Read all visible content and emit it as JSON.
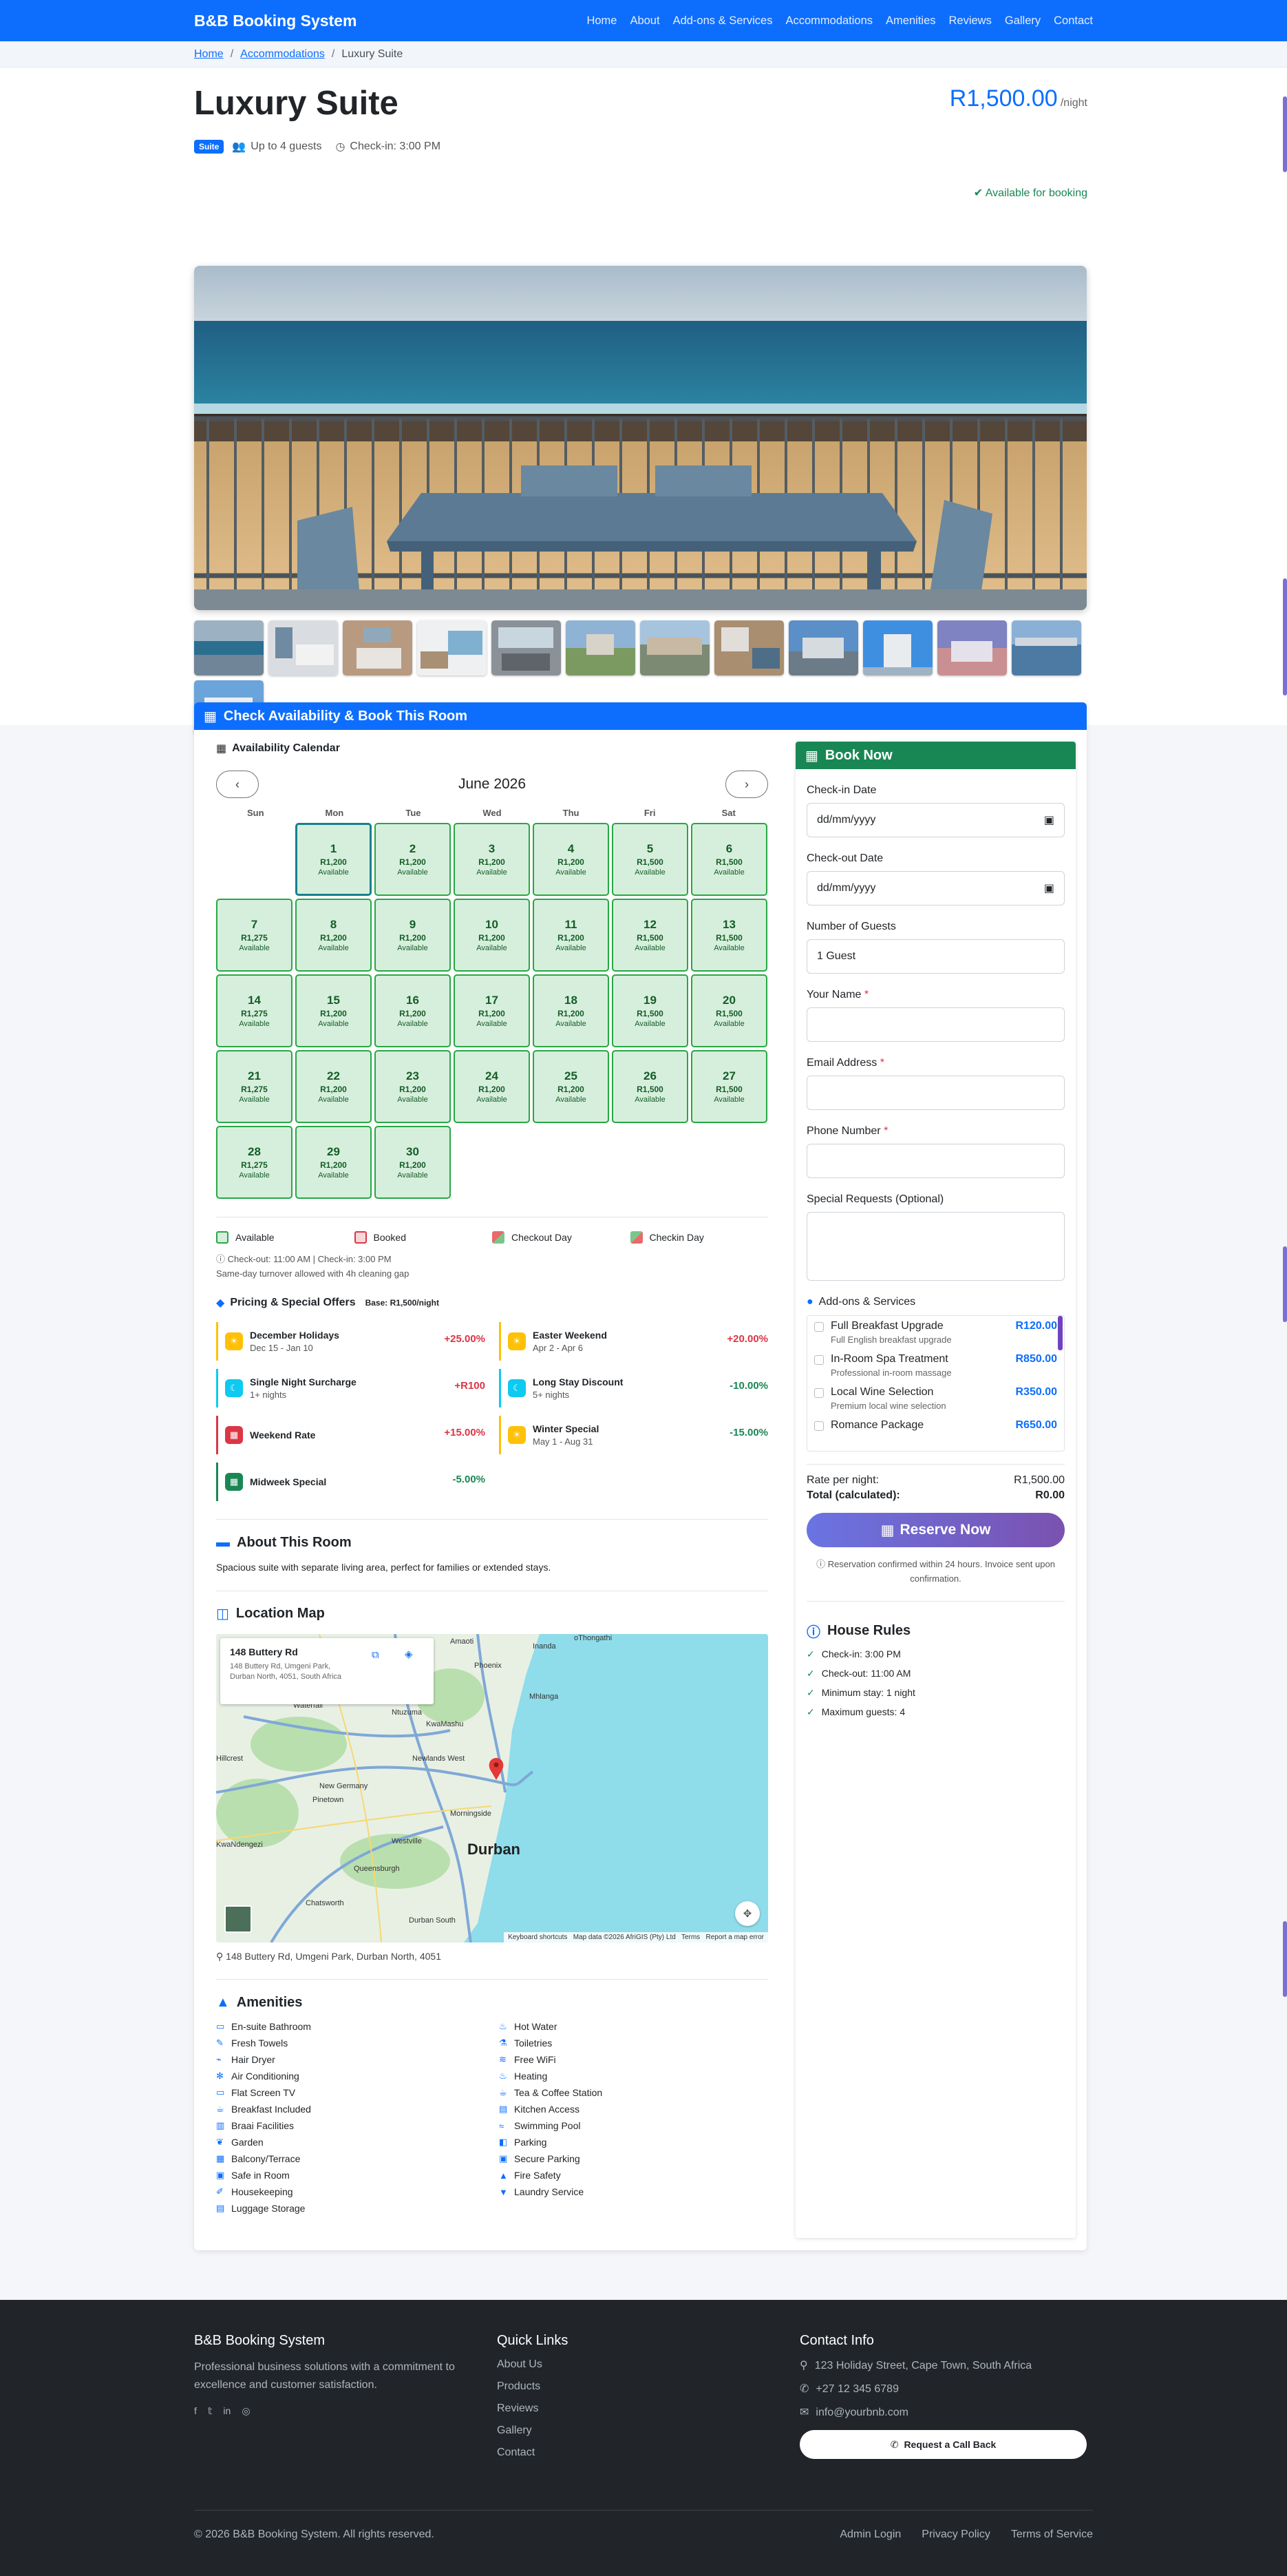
{
  "nav": {
    "brand": "B&B Booking System",
    "links": [
      "Home",
      "About",
      "Add-ons & Services",
      "Accommodations",
      "Amenities",
      "Reviews",
      "Gallery",
      "Contact"
    ]
  },
  "breadcrumb": {
    "home": "Home",
    "accommodations": "Accommodations",
    "current": "Luxury Suite",
    "separator": "/"
  },
  "room": {
    "title": "Luxury Suite",
    "badge": "Suite",
    "guests": "Up to 4 guests",
    "checkin": "Check-in: 3:00 PM",
    "price": "R1,500.00",
    "per_night": "/night",
    "availability": "Available for booking"
  },
  "calendar": {
    "section_title": "Check Availability & Book This Room",
    "title": "Availability Calendar",
    "month": "June 2026",
    "prev": "‹",
    "next": "›",
    "weekdays": [
      "Sun",
      "Mon",
      "Tue",
      "Wed",
      "Thu",
      "Fri",
      "Sat"
    ],
    "days": [
      {
        "d": "1",
        "p": "R1,200",
        "s": "Available"
      },
      {
        "d": "2",
        "p": "R1,200",
        "s": "Available"
      },
      {
        "d": "3",
        "p": "R1,200",
        "s": "Available"
      },
      {
        "d": "4",
        "p": "R1,200",
        "s": "Available"
      },
      {
        "d": "5",
        "p": "R1,500",
        "s": "Available"
      },
      {
        "d": "6",
        "p": "R1,500",
        "s": "Available"
      },
      {
        "d": "7",
        "p": "R1,275",
        "s": "Available"
      },
      {
        "d": "8",
        "p": "R1,200",
        "s": "Available"
      },
      {
        "d": "9",
        "p": "R1,200",
        "s": "Available"
      },
      {
        "d": "10",
        "p": "R1,200",
        "s": "Available"
      },
      {
        "d": "11",
        "p": "R1,200",
        "s": "Available"
      },
      {
        "d": "12",
        "p": "R1,500",
        "s": "Available"
      },
      {
        "d": "13",
        "p": "R1,500",
        "s": "Available"
      },
      {
        "d": "14",
        "p": "R1,275",
        "s": "Available"
      },
      {
        "d": "15",
        "p": "R1,200",
        "s": "Available"
      },
      {
        "d": "16",
        "p": "R1,200",
        "s": "Available"
      },
      {
        "d": "17",
        "p": "R1,200",
        "s": "Available"
      },
      {
        "d": "18",
        "p": "R1,200",
        "s": "Available"
      },
      {
        "d": "19",
        "p": "R1,500",
        "s": "Available"
      },
      {
        "d": "20",
        "p": "R1,500",
        "s": "Available"
      },
      {
        "d": "21",
        "p": "R1,275",
        "s": "Available"
      },
      {
        "d": "22",
        "p": "R1,200",
        "s": "Available"
      },
      {
        "d": "23",
        "p": "R1,200",
        "s": "Available"
      },
      {
        "d": "24",
        "p": "R1,200",
        "s": "Available"
      },
      {
        "d": "25",
        "p": "R1,200",
        "s": "Available"
      },
      {
        "d": "26",
        "p": "R1,500",
        "s": "Available"
      },
      {
        "d": "27",
        "p": "R1,500",
        "s": "Available"
      },
      {
        "d": "28",
        "p": "R1,275",
        "s": "Available"
      },
      {
        "d": "29",
        "p": "R1,200",
        "s": "Available"
      },
      {
        "d": "30",
        "p": "R1,200",
        "s": "Available"
      }
    ],
    "legend": [
      "Available",
      "Booked",
      "Checkout Day",
      "Checkin Day"
    ],
    "note1": "Check-out: 11:00 AM | Check-in: 3:00 PM",
    "note2": "Same-day turnover allowed with 4h cleaning gap"
  },
  "pricing": {
    "title": "Pricing & Special Offers",
    "base": "Base: R1,500/night",
    "offers": [
      {
        "name": "December Holidays",
        "date": "Dec 15 - Jan 10",
        "value": "+25.00%",
        "color": "#ffc107",
        "icon": "sun-icon"
      },
      {
        "name": "Easter Weekend",
        "date": "Apr 2 - Apr 6",
        "value": "+20.00%",
        "color": "#ffc107",
        "icon": "sun-icon"
      },
      {
        "name": "Single Night Surcharge",
        "date": "1+ nights",
        "value": "+R100",
        "color": "#0dcaf0",
        "icon": "moon-icon"
      },
      {
        "name": "Long Stay Discount",
        "date": "5+ nights",
        "value": "-10.00%",
        "color": "#0dcaf0",
        "icon": "moon-icon"
      },
      {
        "name": "Weekend Rate",
        "date": "",
        "value": "+15.00%",
        "color": "#dc3545",
        "icon": "calendar-icon"
      },
      {
        "name": "Winter Special",
        "date": "May 1 - Aug 31",
        "value": "-15.00%",
        "color": "#ffc107",
        "icon": "sun-icon"
      },
      {
        "name": "Midweek Special",
        "date": "",
        "value": "-5.00%",
        "color": "#198754",
        "icon": "calendar-icon"
      }
    ]
  },
  "about": {
    "title": "About This Room",
    "text": "Spacious suite with separate living area, perfect for families or extended stays."
  },
  "map": {
    "title": "Location Map",
    "place": "148 Buttery Rd",
    "place_addr": "148 Buttery Rd, Umgeni Park, Durban North, 4051, South Africa",
    "city": "Durban",
    "labels": [
      "Amaoti",
      "Phoenix",
      "Inanda",
      "oThongathi",
      "Mhlanga",
      "Waterfall",
      "Ntuzuma",
      "KwaMashu",
      "Hillcrest",
      "Newlands West",
      "New Germany",
      "Pinetown",
      "KwaNdengezi",
      "Westville",
      "Queensburgh",
      "Chatsworth",
      "Durban South",
      "Morningside"
    ],
    "attribution": "Keyboard shortcuts   Map data ©2026 AfriGIS (Pty) Ltd   Terms   Report a map error",
    "address": "148 Buttery Rd, Umgeni Park, Durban North, 4051"
  },
  "amenities": {
    "title": "Amenities",
    "items": [
      {
        "label": "En-suite Bathroom",
        "icon": "bath-icon"
      },
      {
        "label": "Hot Water",
        "icon": "tap-icon"
      },
      {
        "label": "Fresh Towels",
        "icon": "towel-icon"
      },
      {
        "label": "Toiletries",
        "icon": "soap-icon"
      },
      {
        "label": "Hair Dryer",
        "icon": "dryer-icon"
      },
      {
        "label": "Free WiFi",
        "icon": "wifi-icon"
      },
      {
        "label": "Air Conditioning",
        "icon": "snowflake-icon"
      },
      {
        "label": "Heating",
        "icon": "flame-icon"
      },
      {
        "label": "Flat Screen TV",
        "icon": "tv-icon"
      },
      {
        "label": "Tea & Coffee Station",
        "icon": "mug-icon"
      },
      {
        "label": "Breakfast Included",
        "icon": "coffee-icon"
      },
      {
        "label": "Kitchen Access",
        "icon": "kitchen-icon"
      },
      {
        "label": "Braai Facilities",
        "icon": "grill-icon"
      },
      {
        "label": "Swimming Pool",
        "icon": "pool-icon"
      },
      {
        "label": "Garden",
        "icon": "leaf-icon"
      },
      {
        "label": "Parking",
        "icon": "car-icon"
      },
      {
        "label": "Balcony/Terrace",
        "icon": "balcony-icon"
      },
      {
        "label": "Secure Parking",
        "icon": "lock-icon"
      },
      {
        "label": "Safe in Room",
        "icon": "safe-icon"
      },
      {
        "label": "Fire Safety",
        "icon": "fire-extinguisher-icon"
      },
      {
        "label": "Housekeeping",
        "icon": "broom-icon"
      },
      {
        "label": "Laundry Service",
        "icon": "shirt-icon"
      },
      {
        "label": "Luggage Storage",
        "icon": "suitcase-icon"
      }
    ]
  },
  "booking": {
    "title": "Book Now",
    "checkin_label": "Check-in Date",
    "checkout_label": "Check-out Date",
    "date_placeholder": "dd/mm/yyyy",
    "guests_label": "Number of Guests",
    "guests_value": "1 Guest",
    "name_label": "Your Name",
    "email_label": "Email Address",
    "phone_label": "Phone Number",
    "requests_label": "Special Requests (Optional)",
    "req": "*",
    "addons_title": "Add-ons & Services",
    "addons": [
      {
        "name": "Full Breakfast Upgrade",
        "desc": "Full English breakfast upgrade",
        "price": "R120.00"
      },
      {
        "name": "In-Room Spa Treatment",
        "desc": "Professional in-room massage",
        "price": "R850.00"
      },
      {
        "name": "Local Wine Selection",
        "desc": "Premium local wine selection",
        "price": "R350.00"
      },
      {
        "name": "Romance Package",
        "desc": "",
        "price": "R650.00"
      }
    ],
    "rate_label": "Rate per night:",
    "rate_value": "R1,500.00",
    "total_label": "Total (calculated):",
    "total_value": "R0.00",
    "reserve": "Reserve Now",
    "confirm": "Reservation confirmed within 24 hours. Invoice sent upon confirmation."
  },
  "rules": {
    "title": "House Rules",
    "items": [
      "Check-in: 3:00 PM",
      "Check-out: 11:00 AM",
      "Minimum stay: 1 night",
      "Maximum guests: 4"
    ]
  },
  "footer": {
    "brand": "B&B Booking System",
    "tagline": "Professional business solutions with a commitment to excellence and customer satisfaction.",
    "links_title": "Quick Links",
    "links": [
      "About Us",
      "Products",
      "Reviews",
      "Gallery",
      "Contact"
    ],
    "contact_title": "Contact Info",
    "address": "123 Holiday Street, Cape Town, South Africa",
    "phone": "+27 12 345 6789",
    "email": "info@yourbnb.com",
    "callback": "Request a Call Back",
    "copyright": "© 2026 B&B Booking System. All rights reserved.",
    "bottom_links": [
      "Admin Login",
      "Privacy Policy",
      "Terms of Service"
    ]
  },
  "colors": {
    "primary": "#0d6efd",
    "success": "#198754",
    "available_bg": "#d6efdc",
    "available_border": "#28a745",
    "footer_bg": "#212529"
  }
}
